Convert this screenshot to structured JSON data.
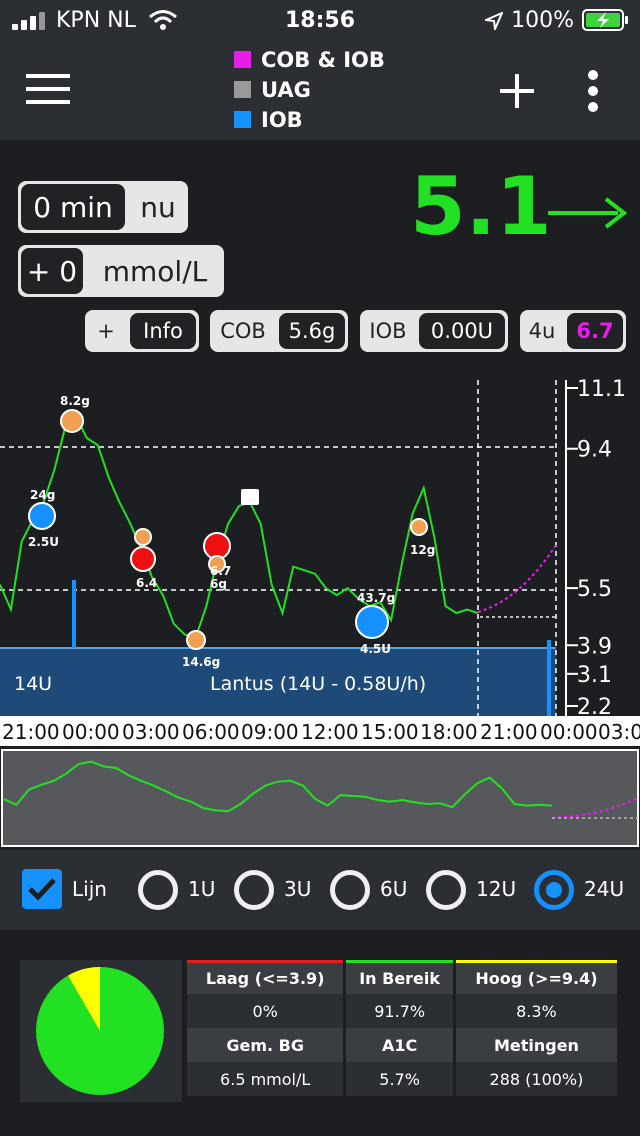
{
  "status_bar": {
    "carrier": "KPN NL",
    "time": "18:56",
    "battery": "100%"
  },
  "header": {
    "legend": [
      {
        "label": "COB & IOB",
        "color": "#e81ee8"
      },
      {
        "label": "UAG",
        "color": "#9a9a9a"
      },
      {
        "label": "IOB",
        "color": "#1592ff"
      }
    ]
  },
  "reading": {
    "minutes": "0 min",
    "minutes_suffix": "nu",
    "delta": "+ 0",
    "unit": "mmol/L",
    "value": "5.1",
    "trend": "→"
  },
  "info_pills": {
    "plus": "+",
    "info": "Info",
    "cob_label": "COB",
    "cob_value": "5.6g",
    "iob_label": "IOB",
    "iob_value": "0.00U",
    "pred_label": "4u",
    "pred_value": "6.7"
  },
  "chart": {
    "y_ticks": [
      "11.1",
      "9.4",
      "5.5",
      "3.9",
      "3.1",
      "2.2"
    ],
    "x_ticks": [
      "21:00",
      "00:00",
      "03:00",
      "06:00",
      "09:00",
      "12:00",
      "15:00",
      "18:00",
      "21:00",
      "00:00",
      "03:0"
    ],
    "basal_left_label": "14U",
    "basal_label": "Lantus (14U - 0.58U/h)",
    "annotations": [
      "8.2g",
      "24g",
      "2.5U",
      "6.4",
      "6g",
      "6.7",
      "14.6g",
      "43.7g",
      "4.5U",
      "12g"
    ]
  },
  "chart_data": {
    "type": "line",
    "title": "",
    "xlabel": "",
    "ylabel": "",
    "ylim": [
      2.2,
      11.1
    ],
    "x": [
      "21:00",
      "21:30",
      "22:00",
      "22:30",
      "23:00",
      "23:30",
      "00:00",
      "00:30",
      "01:00",
      "01:30",
      "02:00",
      "02:30",
      "03:00",
      "03:30",
      "04:00",
      "04:30",
      "05:00",
      "05:30",
      "06:00",
      "06:30",
      "07:00",
      "07:30",
      "08:00",
      "08:30",
      "09:00",
      "09:30",
      "10:00",
      "10:30",
      "11:00",
      "11:30",
      "12:00",
      "12:30",
      "13:00",
      "13:30",
      "14:00",
      "14:30",
      "15:00",
      "15:30",
      "16:00",
      "16:30",
      "17:00",
      "17:30",
      "18:00",
      "18:30",
      "19:00"
    ],
    "series": [
      {
        "values": [
          5.6,
          4.9,
          6.8,
          7.4,
          7.9,
          8.8,
          10.0,
          10.3,
          9.7,
          9.5,
          8.6,
          7.9,
          7.3,
          6.6,
          5.8,
          5.3,
          4.5,
          4.2,
          4.1,
          5.0,
          6.3,
          7.3,
          7.8,
          7.9,
          7.3,
          5.6,
          4.8,
          6.1,
          6.0,
          5.9,
          5.5,
          5.3,
          5.5,
          5.2,
          5.0,
          5.1,
          4.6,
          6.2,
          7.6,
          8.3,
          6.9,
          5.0,
          4.8,
          4.9,
          4.8
        ]
      }
    ],
    "grid": false
  },
  "overview_ylim": [
    0,
    12
  ],
  "radio": {
    "checkbox_label": "Lijn",
    "options": [
      "1U",
      "3U",
      "6U",
      "12U",
      "24U"
    ],
    "selected": "24U"
  },
  "stats": {
    "pie_in_range_pct": 91.7,
    "headers1": [
      "Laag (<=3.9)",
      "In Bereik",
      "Hoog (>=9.4)"
    ],
    "values1": [
      "0%",
      "91.7%",
      "8.3%"
    ],
    "headers2": [
      "Gem. BG",
      "A1C",
      "Metingen"
    ],
    "values2": [
      "6.5 mmol/L",
      "5.7%",
      "288 (100%)"
    ],
    "colors": {
      "low": "#e02020",
      "range": "#22e022",
      "high": "#ffff00"
    }
  }
}
